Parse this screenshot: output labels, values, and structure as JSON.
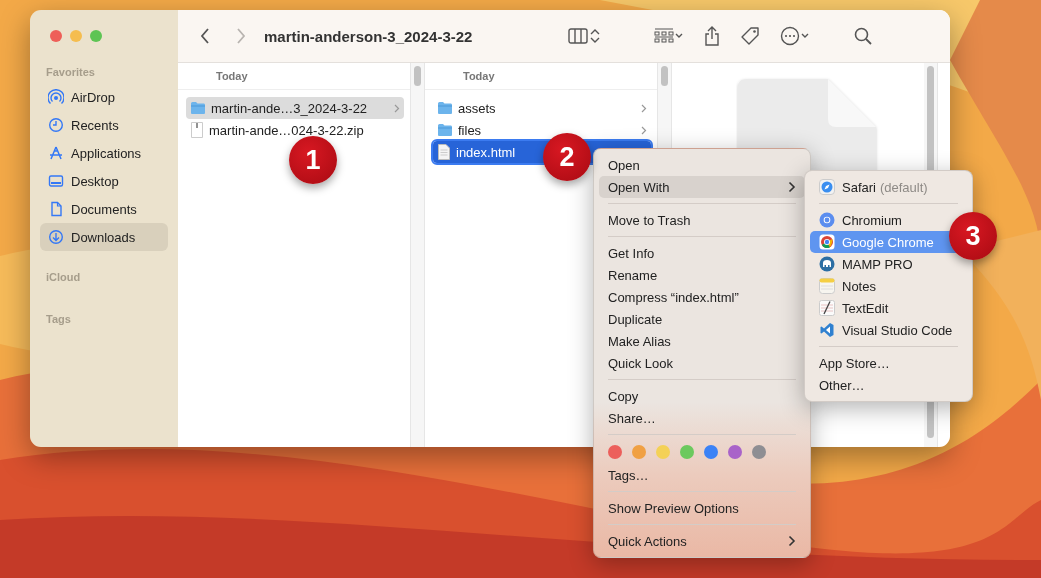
{
  "window": {
    "title": "martin-anderson-3_2024-3-22",
    "nav": [
      {
        "kind": "back",
        "disabled": false
      },
      {
        "kind": "forward",
        "disabled": true
      }
    ]
  },
  "sidebar": {
    "sections": [
      {
        "label": "Favorites",
        "items": [
          {
            "label": "AirDrop",
            "selected": false
          },
          {
            "label": "Recents",
            "selected": false
          },
          {
            "label": "Applications",
            "selected": false
          },
          {
            "label": "Desktop",
            "selected": false
          },
          {
            "label": "Documents",
            "selected": false
          },
          {
            "label": "Downloads",
            "selected": true
          }
        ]
      },
      {
        "label": "iCloud"
      },
      {
        "label": "Tags"
      }
    ]
  },
  "columns": [
    {
      "header": "Today",
      "focused": false,
      "rows": [
        {
          "kind": "folder",
          "name": "martin-ande…3_2024-3-22",
          "selected": true,
          "expandable": true
        },
        {
          "kind": "zip",
          "name": "martin-ande…024-3-22.zip",
          "selected": false,
          "expandable": false
        }
      ]
    },
    {
      "header": "Today",
      "focused": true,
      "rows": [
        {
          "kind": "folder",
          "name": "assets",
          "selected": false,
          "expandable": true
        },
        {
          "kind": "folder",
          "name": "files",
          "selected": false,
          "expandable": true
        },
        {
          "kind": "file",
          "name": "index.html",
          "selected": true,
          "expandable": false
        }
      ]
    }
  ],
  "context_menu": {
    "items": [
      {
        "kind": "item",
        "label": "Open",
        "selected": false,
        "submenu": false
      },
      {
        "kind": "item",
        "label": "Open With",
        "selected": true,
        "submenu": true
      },
      {
        "kind": "separator"
      },
      {
        "kind": "item",
        "label": "Move to Trash",
        "selected": false,
        "submenu": false
      },
      {
        "kind": "separator"
      },
      {
        "kind": "item",
        "label": "Get Info",
        "selected": false,
        "submenu": false
      },
      {
        "kind": "item",
        "label": "Rename",
        "selected": false,
        "submenu": false
      },
      {
        "kind": "item",
        "label": "Compress “index.html”",
        "selected": false,
        "submenu": false
      },
      {
        "kind": "item",
        "label": "Duplicate",
        "selected": false,
        "submenu": false
      },
      {
        "kind": "item",
        "label": "Make Alias",
        "selected": false,
        "submenu": false
      },
      {
        "kind": "item",
        "label": "Quick Look",
        "selected": false,
        "submenu": false
      },
      {
        "kind": "separator"
      },
      {
        "kind": "item",
        "label": "Copy",
        "selected": false,
        "submenu": false
      },
      {
        "kind": "item",
        "label": "Share…",
        "selected": false,
        "submenu": false
      },
      {
        "kind": "separator"
      },
      {
        "kind": "tags",
        "tags": [
          {
            "color": "#ec5f5b"
          },
          {
            "color": "#f0a043"
          },
          {
            "color": "#f4d156"
          },
          {
            "color": "#6cc95e"
          },
          {
            "color": "#3b82f6"
          },
          {
            "color": "#a963c9"
          },
          {
            "color": "#8e8e93"
          }
        ]
      },
      {
        "kind": "item",
        "label": "Tags…",
        "selected": false,
        "submenu": false
      },
      {
        "kind": "separator"
      },
      {
        "kind": "item",
        "label": "Show Preview Options",
        "selected": false,
        "submenu": false
      },
      {
        "kind": "separator"
      },
      {
        "kind": "item",
        "label": "Quick Actions",
        "selected": false,
        "submenu": true
      }
    ]
  },
  "open_with_menu": {
    "items": [
      {
        "kind": "app",
        "label": "Safari",
        "note": "(default)",
        "selected": false
      },
      {
        "kind": "separator"
      },
      {
        "kind": "app",
        "label": "Chromium",
        "selected": false
      },
      {
        "kind": "app",
        "label": "Google Chrome",
        "selected": true
      },
      {
        "kind": "app",
        "label": "MAMP PRO",
        "selected": false
      },
      {
        "kind": "app",
        "label": "Notes",
        "selected": false
      },
      {
        "kind": "app",
        "label": "TextEdit",
        "selected": false
      },
      {
        "kind": "app",
        "label": "Visual Studio Code",
        "selected": false
      },
      {
        "kind": "separator"
      },
      {
        "kind": "item",
        "label": "App Store…",
        "selected": false
      },
      {
        "kind": "item",
        "label": "Other…",
        "selected": false
      }
    ]
  },
  "callouts": [
    "1",
    "2",
    "3"
  ]
}
